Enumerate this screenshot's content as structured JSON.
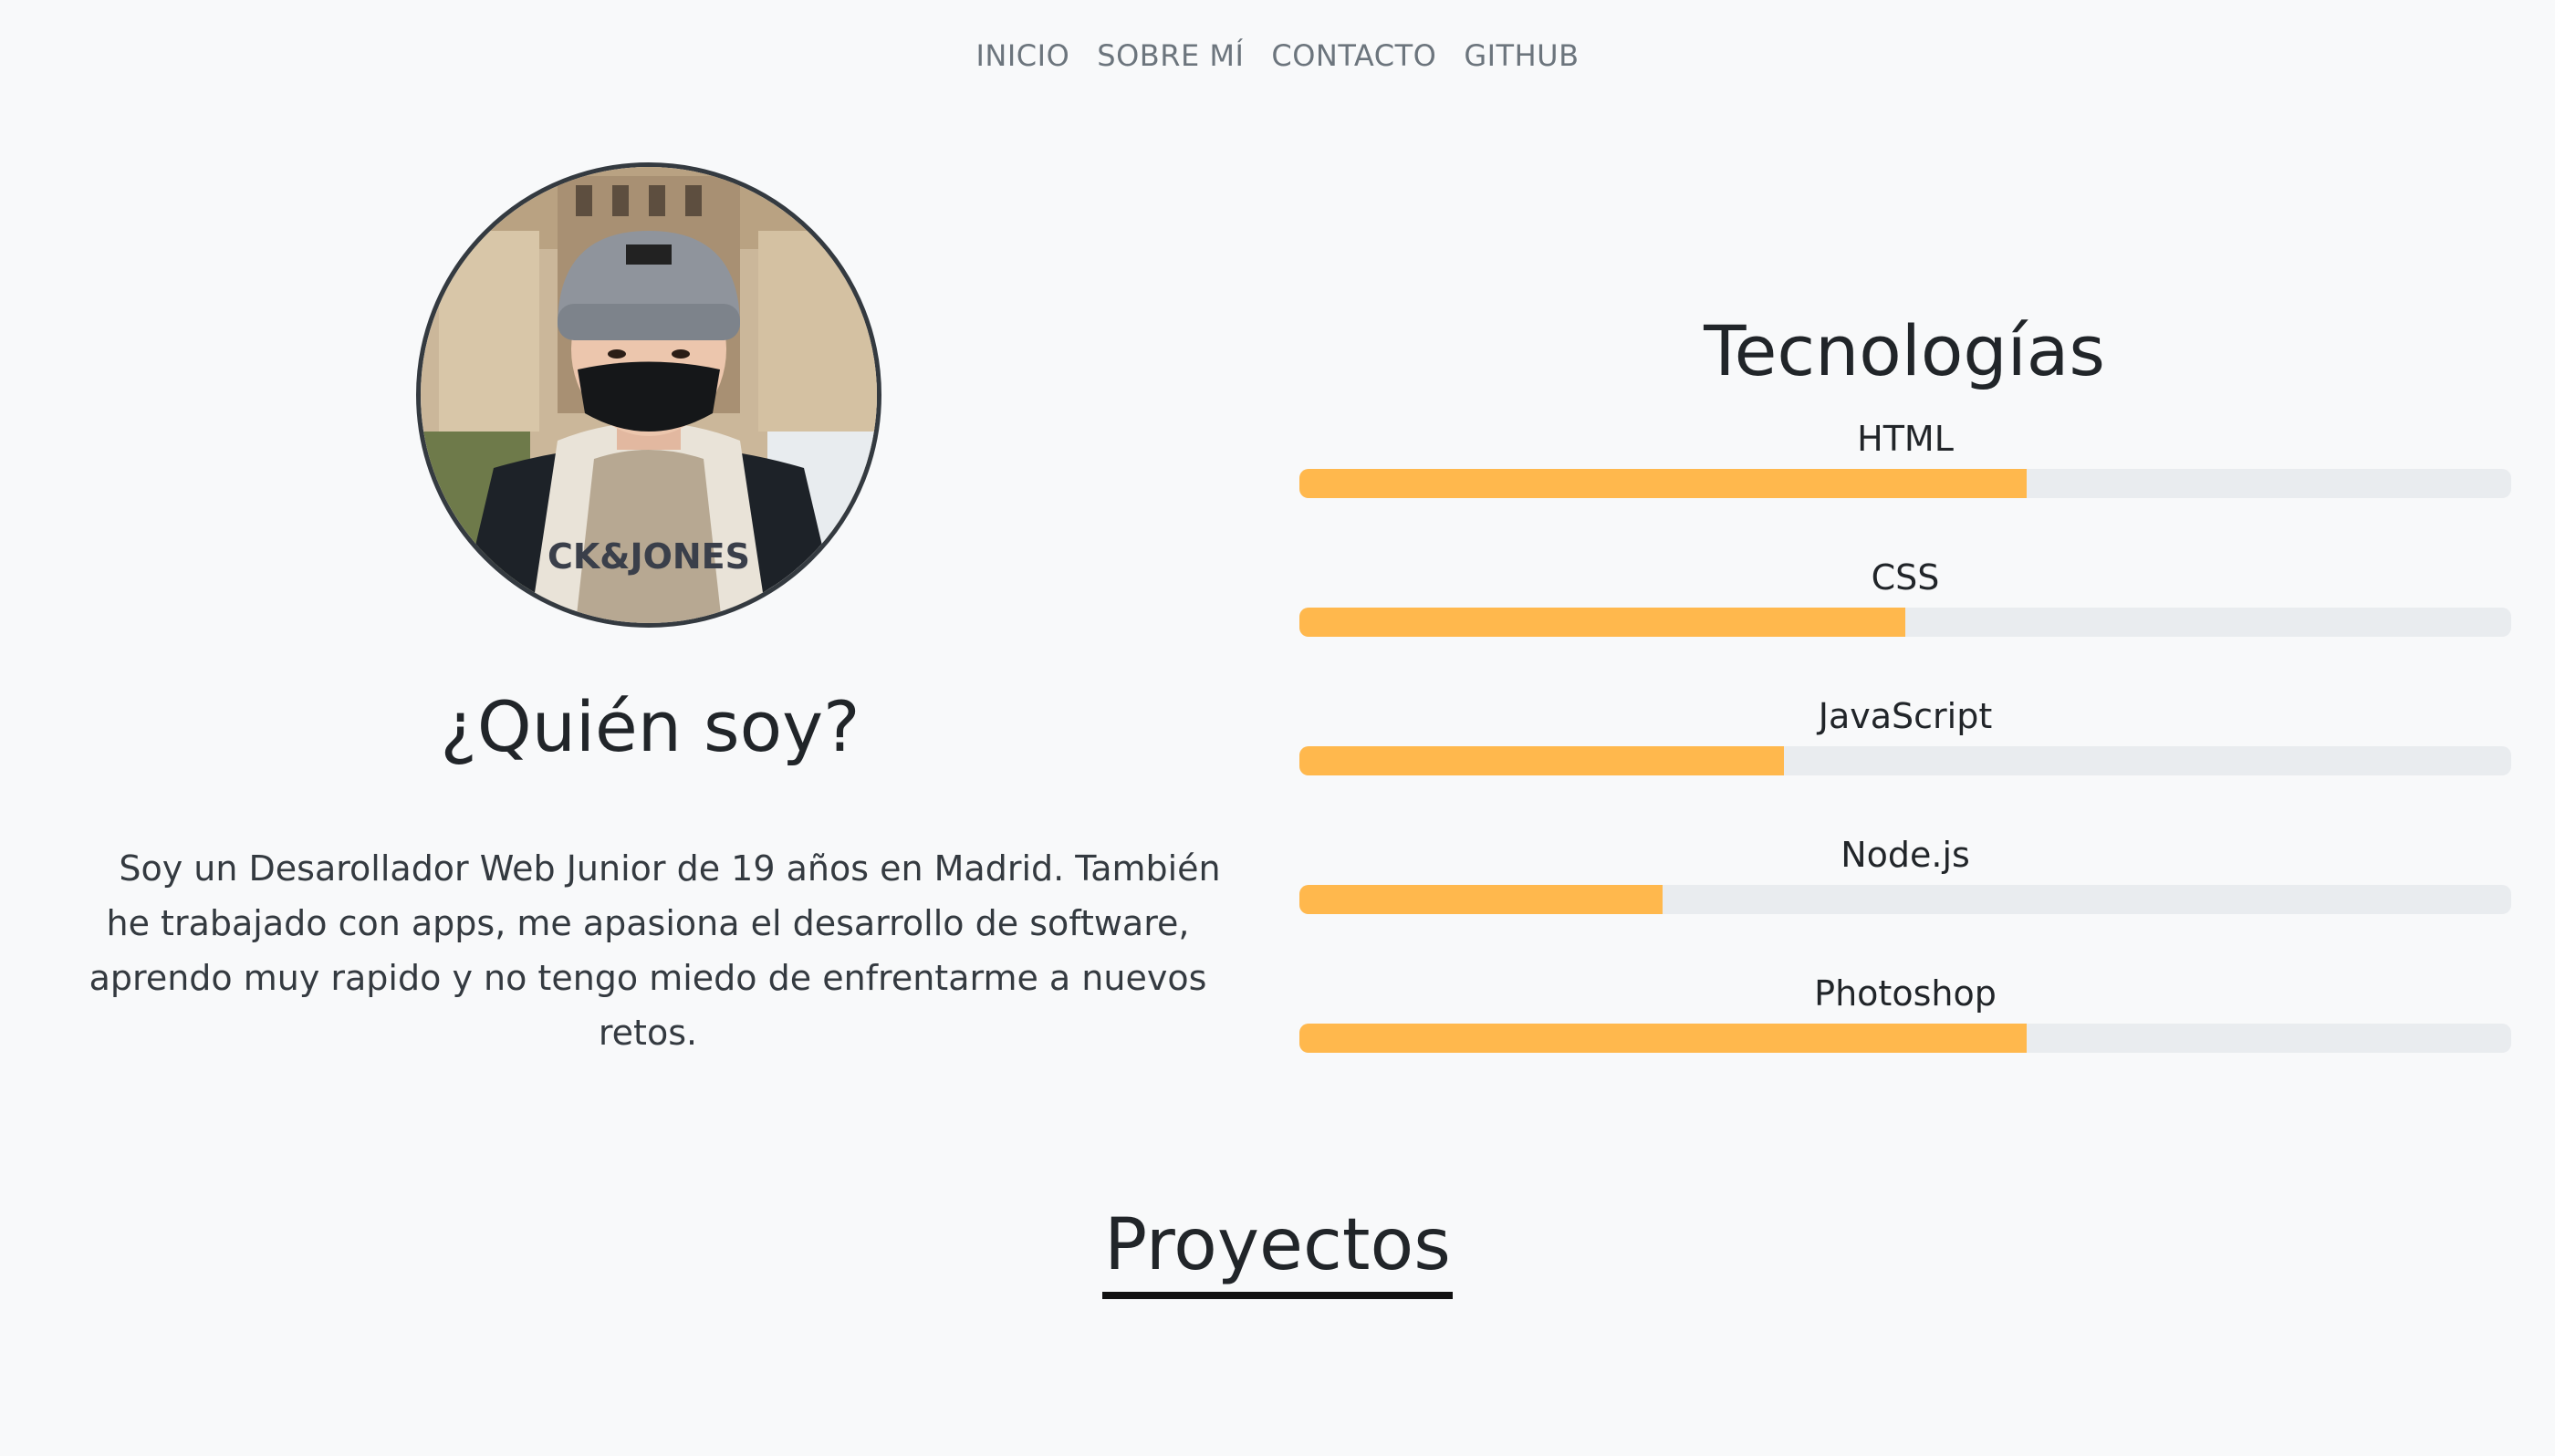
{
  "nav": {
    "items": [
      "INICIO",
      "SOBRE MÍ",
      "CONTACTO",
      "GITHUB"
    ]
  },
  "about": {
    "avatar_icon": "profile-photo",
    "title": "¿Quién soy?",
    "bio": "Soy un Desarollador Web Junior de 19 años en Madrid. También he trabajado con apps, me apasiona el desarrollo de software, aprendo muy rapido y no tengo miedo de enfrentarme a nuevos retos."
  },
  "tech": {
    "title": "Tecnologías",
    "accent_color": "#ffb84d",
    "track_color": "#e9ecef",
    "skills": [
      {
        "name": "HTML",
        "level": 0.6
      },
      {
        "name": "CSS",
        "level": 0.5
      },
      {
        "name": "JavaScript",
        "level": 0.4
      },
      {
        "name": "Node.js",
        "level": 0.3
      },
      {
        "name": "Photoshop",
        "level": 0.6
      }
    ]
  },
  "projects": {
    "title": "Proyectos"
  }
}
